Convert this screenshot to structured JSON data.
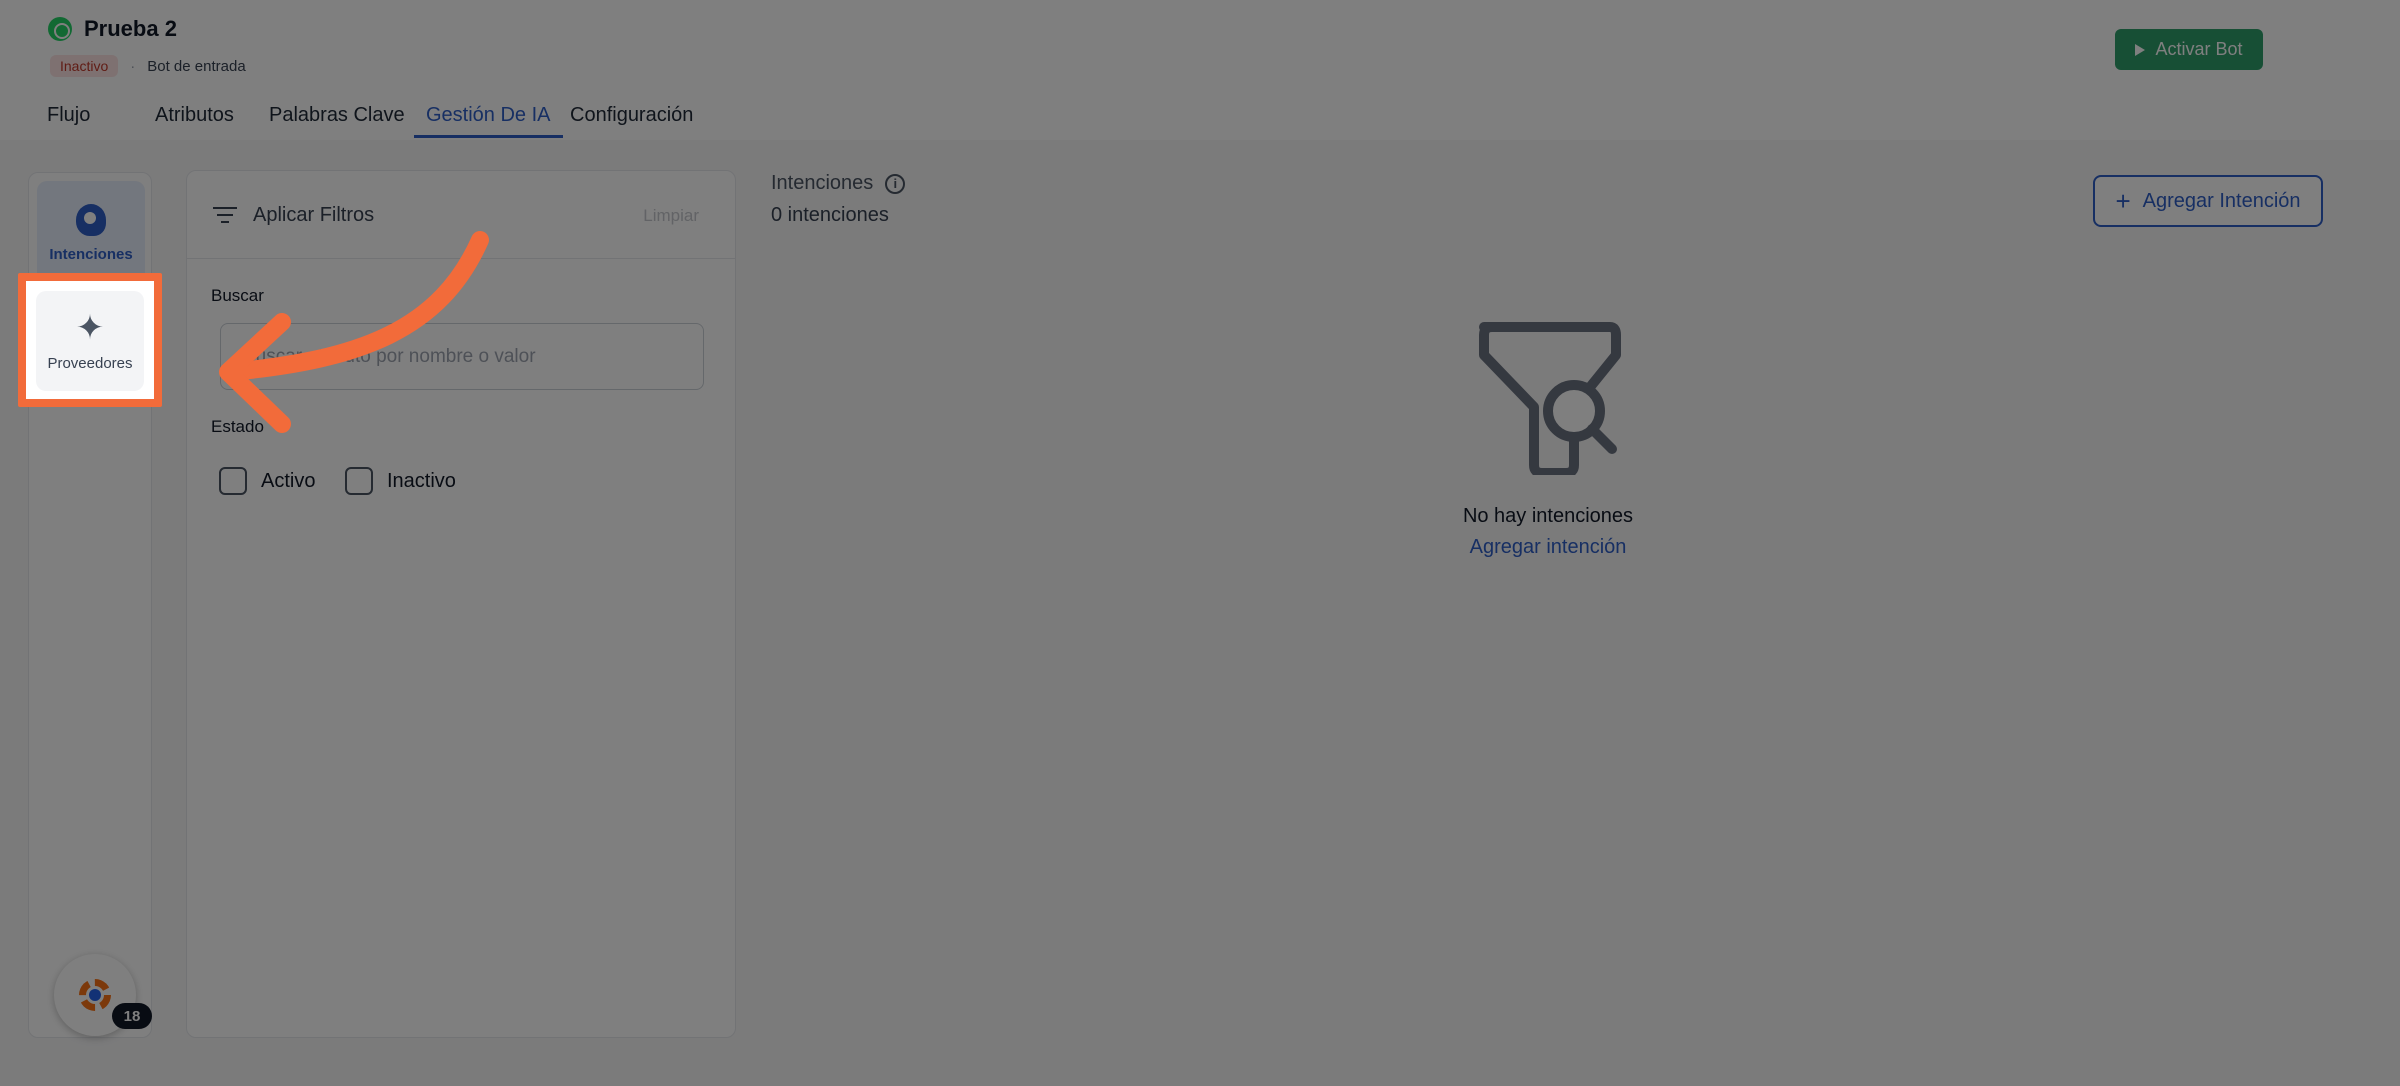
{
  "header": {
    "bot_name": "Prueba 2",
    "status": "Inactivo",
    "bot_type": "Bot de entrada",
    "separator": "·",
    "activate_label": "Activar Bot"
  },
  "tabs": [
    {
      "label": "Flujo"
    },
    {
      "label": "Atributos"
    },
    {
      "label": "Palabras Clave"
    },
    {
      "label": "Gestión De IA"
    },
    {
      "label": "Configuración"
    }
  ],
  "sidebar": {
    "intents_label": "Intenciones",
    "providers_label": "Proveedores",
    "notification_count": "18"
  },
  "filters": {
    "title": "Aplicar Filtros",
    "clear_label": "Limpiar",
    "search_label": "Buscar",
    "search_placeholder": "Buscar atributo por nombre o valor",
    "state_label": "Estado",
    "active_label": "Activo",
    "inactive_label": "Inactivo"
  },
  "main": {
    "section_title": "Intenciones",
    "count_text": "0 intenciones",
    "add_button_label": "Agregar Intención",
    "empty_title": "No hay intenciones",
    "empty_link": "Agregar intención"
  },
  "colors": {
    "accent": "#2f5fc7",
    "activate_bg": "#2e9e6a",
    "highlight": "#f26b3a"
  }
}
